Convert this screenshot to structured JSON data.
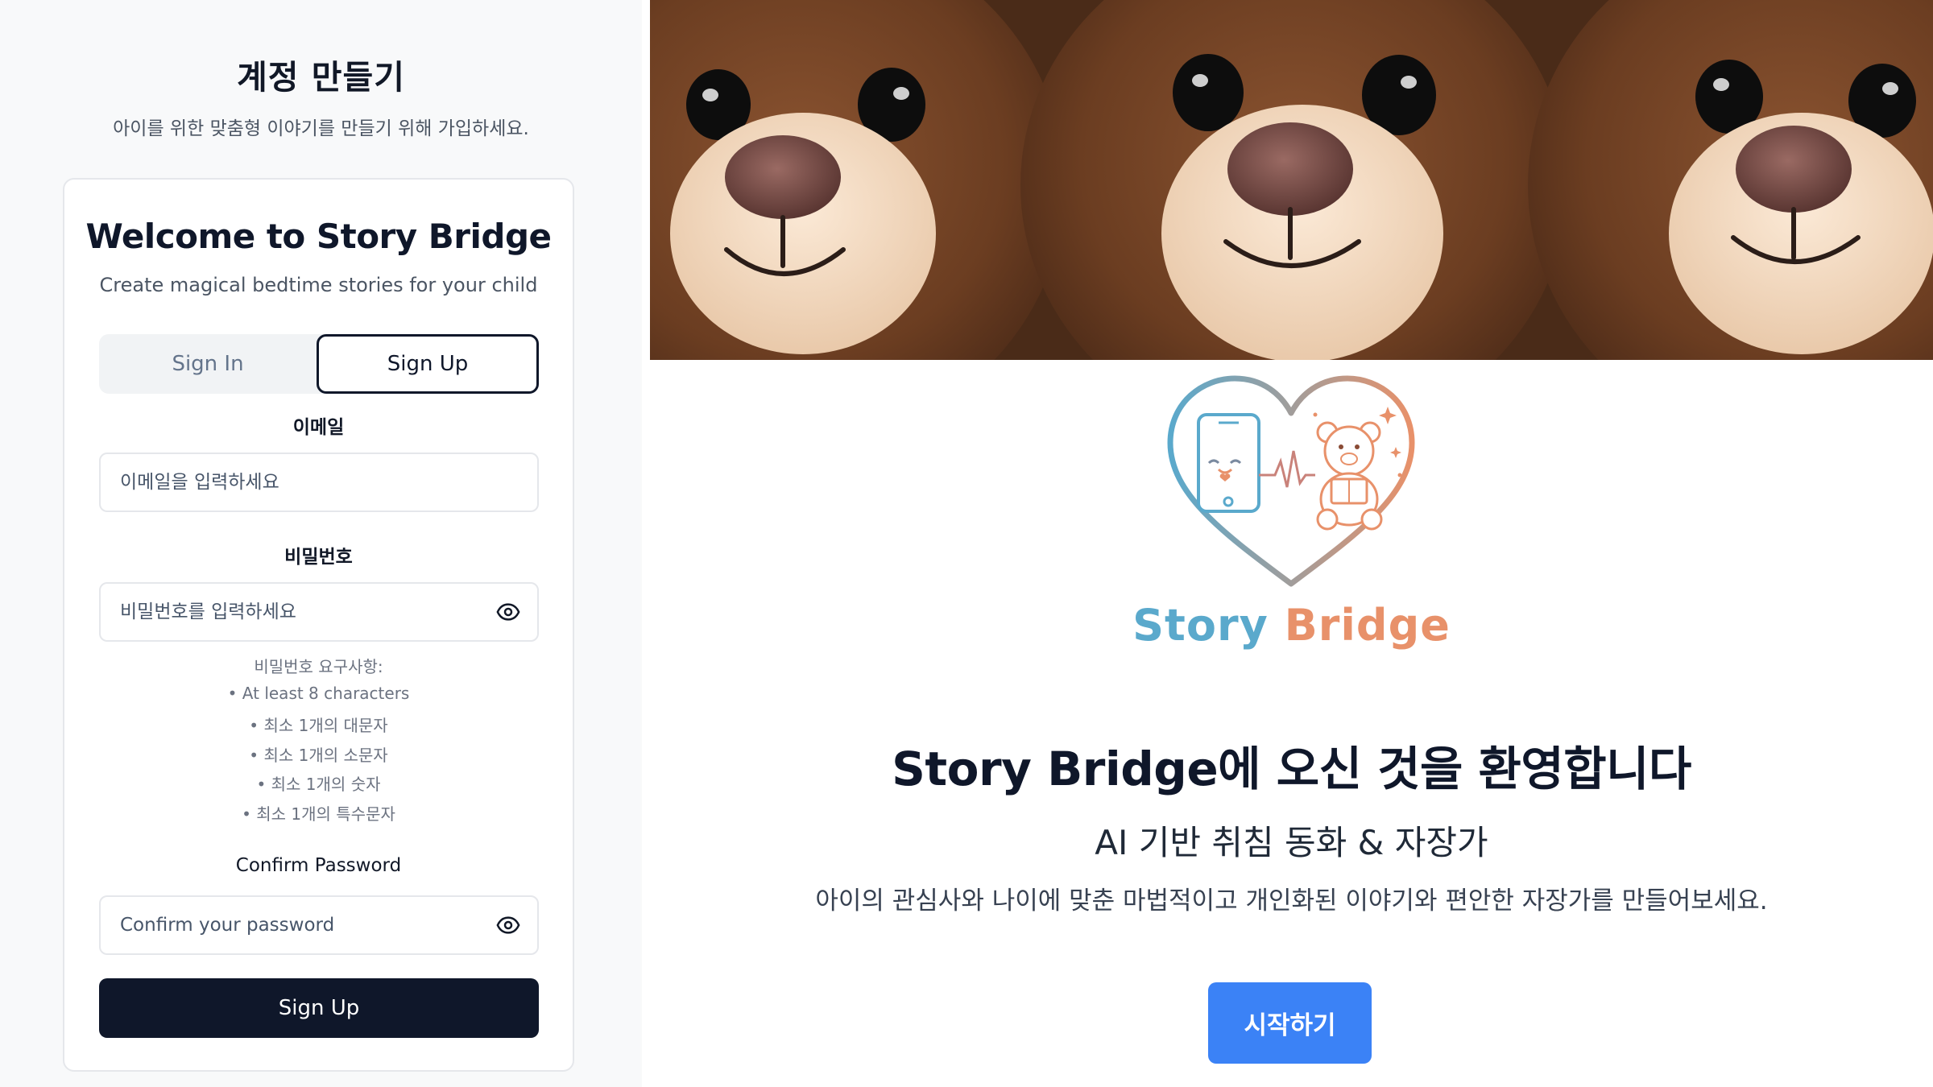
{
  "signup_panel": {
    "page_title": "계정 만들기",
    "page_subtitle": "아이를 위한 맞춤형 이야기를 만들기 위해 가입하세요.",
    "card": {
      "title": "Welcome to Story Bridge",
      "subtitle": "Create magical bedtime stories for your child",
      "tabs": [
        {
          "label": "Sign In",
          "active": false
        },
        {
          "label": "Sign Up",
          "active": true
        }
      ],
      "email": {
        "label": "이메일",
        "placeholder": "이메일을 입력하세요",
        "value": ""
      },
      "password": {
        "label": "비밀번호",
        "placeholder": "비밀번호를 입력하세요",
        "value": "",
        "toggle_icon": "eye-icon"
      },
      "requirements": {
        "title": "비밀번호 요구사항:",
        "items": [
          "• At least 8 characters",
          "• 최소 1개의 대문자",
          "• 최소 1개의 소문자",
          "• 최소 1개의 숫자",
          "• 최소 1개의 특수문자"
        ]
      },
      "confirm_password": {
        "label": "Confirm Password",
        "placeholder": "Confirm your password",
        "value": "",
        "toggle_icon": "eye-icon"
      },
      "submit_label": "Sign Up"
    }
  },
  "landing": {
    "hero_image": "teddy-bears-photo",
    "logo_icon": "heart-phone-teddy-logo",
    "brand": {
      "part1": "Story",
      "part2": "Bridge"
    },
    "welcome": "Story Bridge에 오신 것을 환영합니다",
    "tagline": "AI 기반 취침 동화 & 자장가",
    "description": "아이의 관심사와 나이에 맞춘 마법적이고 개인화된 이야기와 편안한 자장가를 만들어보세요.",
    "start_label": "시작하기"
  },
  "colors": {
    "primary_dark": "#0f172a",
    "start_button": "#3b82f6",
    "brand_blue": "#5aa9cc",
    "brand_orange": "#e8916a"
  }
}
